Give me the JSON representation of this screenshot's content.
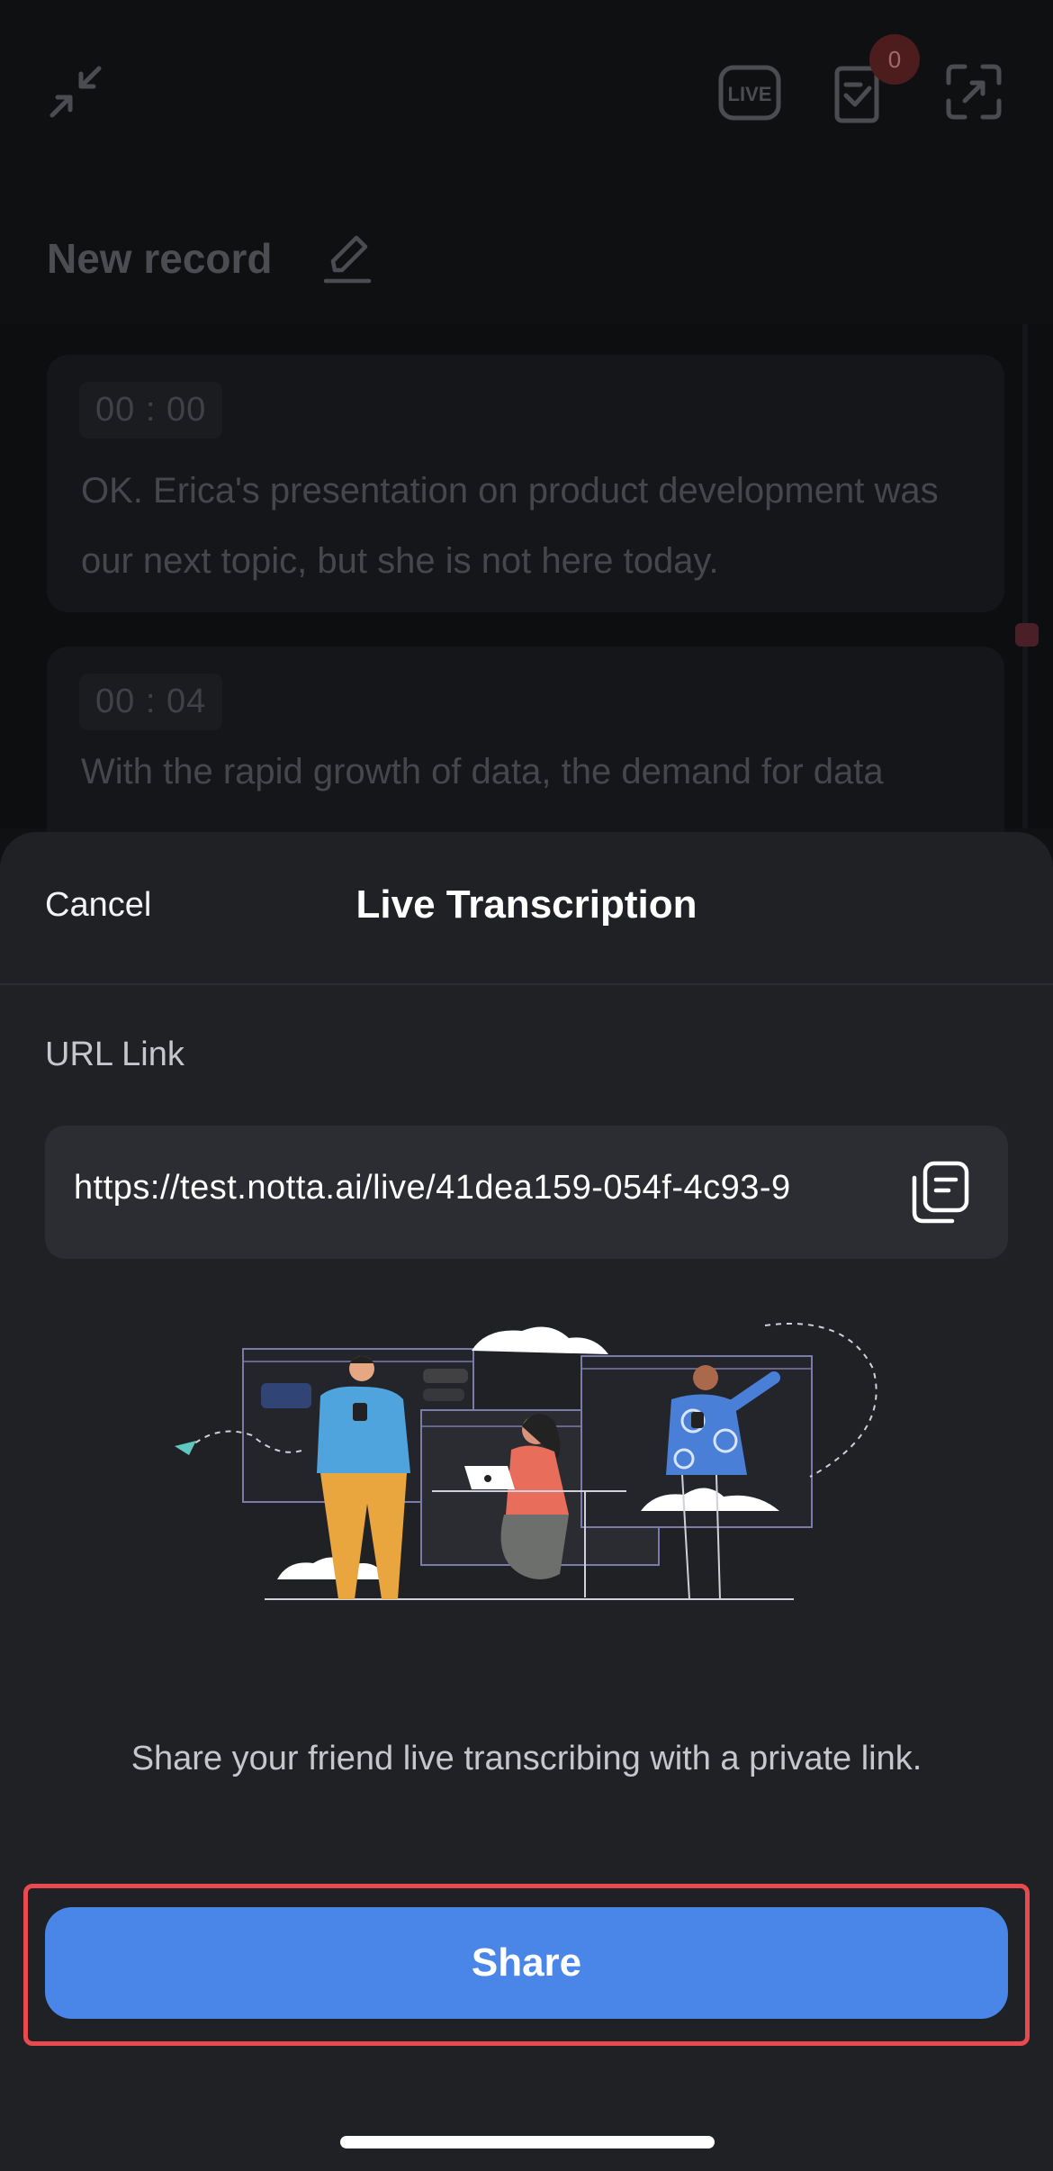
{
  "background": {
    "badge_count": "0",
    "record_title": "New record",
    "transcripts": [
      {
        "timestamp": "00 : 00",
        "text": "OK. Erica's presentation on product development was our next topic, but she is not here today."
      },
      {
        "timestamp": "00 : 04",
        "text": "With the rapid growth of data, the demand for data"
      }
    ],
    "icons": [
      "collapse-icon",
      "live-icon",
      "notes-icon",
      "expand-icon",
      "edit-icon"
    ]
  },
  "sheet": {
    "cancel_label": "Cancel",
    "title": "Live Transcription",
    "url_label": "URL Link",
    "url_value": "https://test.notta.ai/live/41dea159-054f-4c93-9",
    "description": "Share your friend live transcribing with a private link.",
    "share_label": "Share"
  },
  "colors": {
    "accent": "#4a86e8",
    "highlight": "#e84a4f",
    "sheet_bg": "#1f2125",
    "field_bg": "#2b2d32"
  }
}
